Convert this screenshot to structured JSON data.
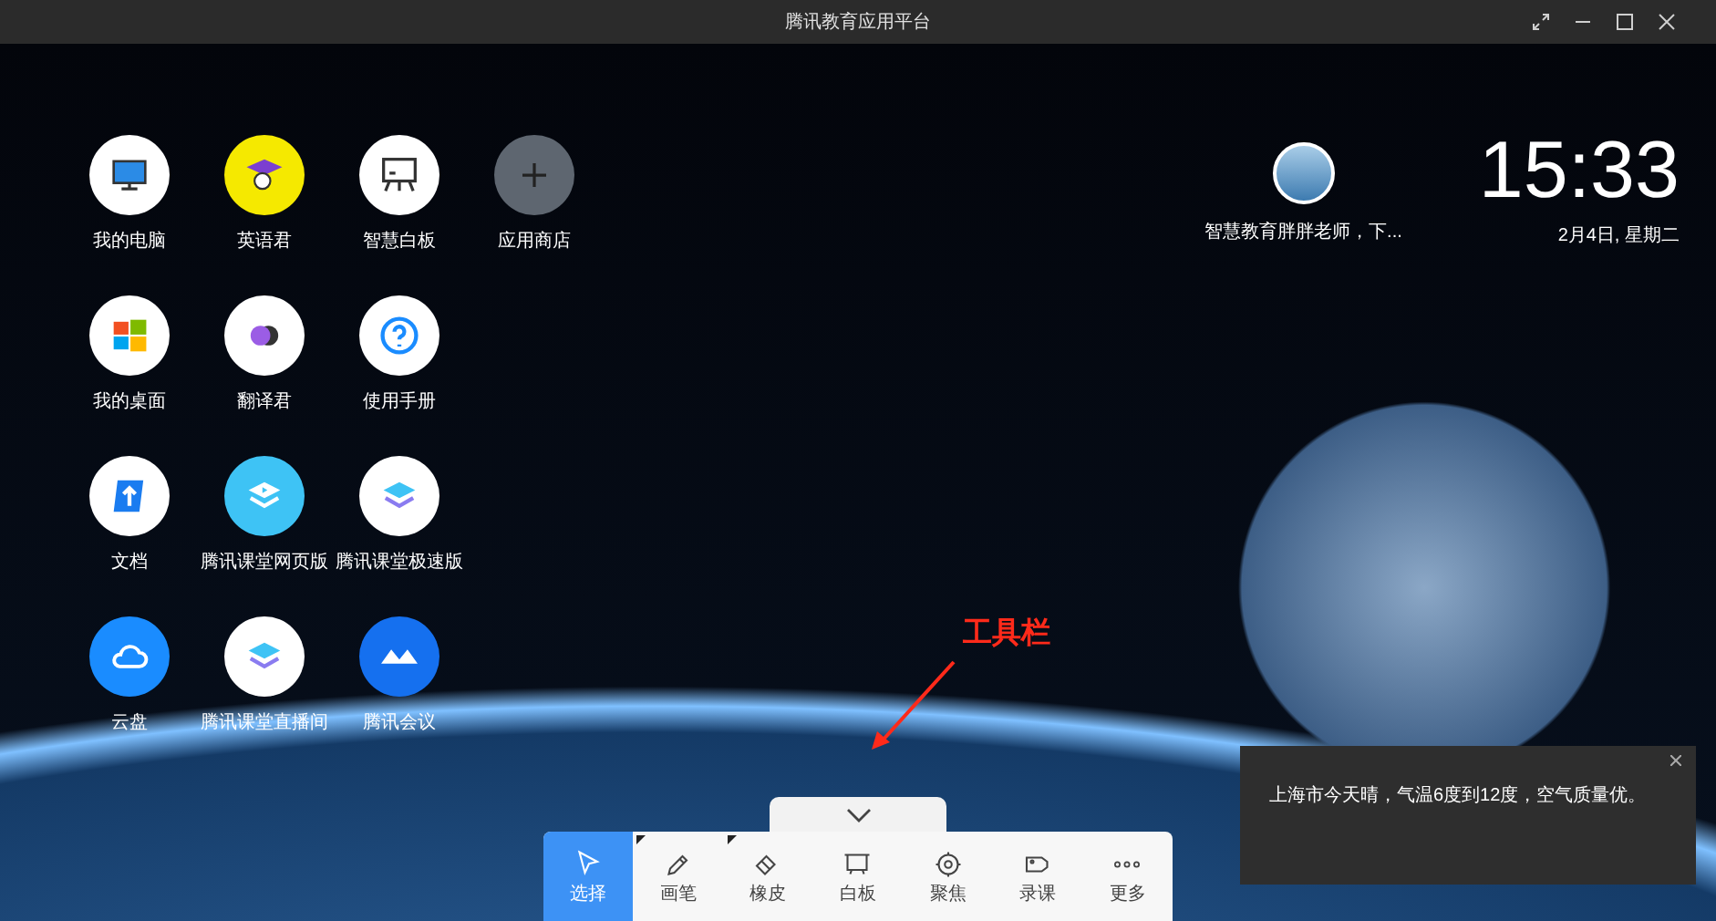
{
  "window": {
    "title": "腾讯教育应用平台"
  },
  "app_rows": [
    [
      {
        "label": "我的电脑"
      },
      {
        "label": "英语君"
      },
      {
        "label": "智慧白板"
      },
      {
        "label": "应用商店"
      }
    ],
    [
      {
        "label": "我的桌面"
      },
      {
        "label": "翻译君"
      },
      {
        "label": "使用手册"
      }
    ],
    [
      {
        "label": "文档"
      },
      {
        "label": "腾讯课堂网页版"
      },
      {
        "label": "腾讯课堂极速版"
      }
    ],
    [
      {
        "label": "云盘"
      },
      {
        "label": "腾讯课堂直播间"
      },
      {
        "label": "腾讯会议"
      }
    ]
  ],
  "profile": {
    "name": "智慧教育胖胖老师，下..."
  },
  "clock": {
    "time": "15:33",
    "date": "2月4日, 星期二"
  },
  "annotation": {
    "text": "工具栏"
  },
  "notification": {
    "text": "上海市今天晴，气温6度到12度，空气质量优。"
  },
  "toolbar": [
    {
      "label": "选择",
      "selected": true,
      "corner_mark": false
    },
    {
      "label": "画笔",
      "selected": false,
      "corner_mark": true
    },
    {
      "label": "橡皮",
      "selected": false,
      "corner_mark": true
    },
    {
      "label": "白板",
      "selected": false,
      "corner_mark": false
    },
    {
      "label": "聚焦",
      "selected": false,
      "corner_mark": false
    },
    {
      "label": "录课",
      "selected": false,
      "corner_mark": false
    },
    {
      "label": "更多",
      "selected": false,
      "corner_mark": false
    }
  ]
}
